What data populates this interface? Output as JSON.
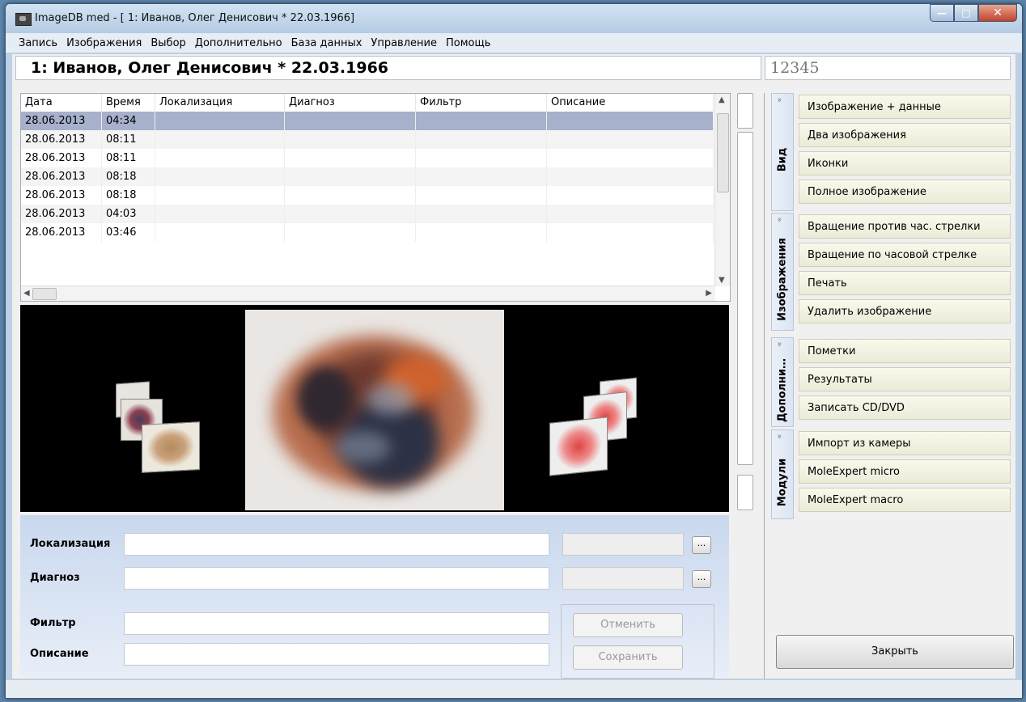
{
  "window": {
    "title": "ImageDB med - [  1: Иванов, Олег Денисович   * 22.03.1966]"
  },
  "menu": [
    "Запись",
    "Изображения",
    "Выбор",
    "Дополнительно",
    "База данных",
    "Управление",
    "Помощь"
  ],
  "patient": {
    "name": "1: Иванов, Олег Денисович   * 22.03.1966",
    "id": "12345"
  },
  "table": {
    "columns": [
      "Дата",
      "Время",
      "Локализация",
      "Диагноз",
      "Фильтр",
      "Описание"
    ],
    "rows": [
      {
        "date": "28.06.2013",
        "time": "04:34",
        "selected": true
      },
      {
        "date": "28.06.2013",
        "time": "08:11"
      },
      {
        "date": "28.06.2013",
        "time": "08:11"
      },
      {
        "date": "28.06.2013",
        "time": "08:18"
      },
      {
        "date": "28.06.2013",
        "time": "08:18"
      },
      {
        "date": "28.06.2013",
        "time": "04:03"
      },
      {
        "date": "28.06.2013",
        "time": "03:46"
      }
    ]
  },
  "form": {
    "localization_label": "Локализация",
    "diagnosis_label": "Диагноз",
    "filter_label": "Фильтр",
    "description_label": "Описание",
    "browse_label": "...",
    "cancel_label": "Отменить",
    "save_label": "Сохранить"
  },
  "panel": {
    "groups": [
      {
        "tab": "Вид",
        "items": [
          "Изображение + данные",
          "Два изображения",
          "Иконки",
          "Полное изображение"
        ]
      },
      {
        "tab": "Изображения",
        "items": [
          "Вращение против час. стрелки",
          "Вращение по часовой стрелке",
          "Печать",
          "Удалить изображение"
        ]
      },
      {
        "tab": "Дополни…",
        "items": [
          "Пометки",
          "Результаты",
          "Записать CD/DVD"
        ]
      },
      {
        "tab": "Модули",
        "items": [
          "Импорт из камеры",
          "MoleExpert micro",
          "MoleExpert macro"
        ]
      }
    ],
    "close_label": "Закрыть"
  },
  "colors": {
    "selected_row": "#a7b1cc",
    "action_button": "#f4f3e3",
    "window_frame": "#bcd0e6"
  }
}
